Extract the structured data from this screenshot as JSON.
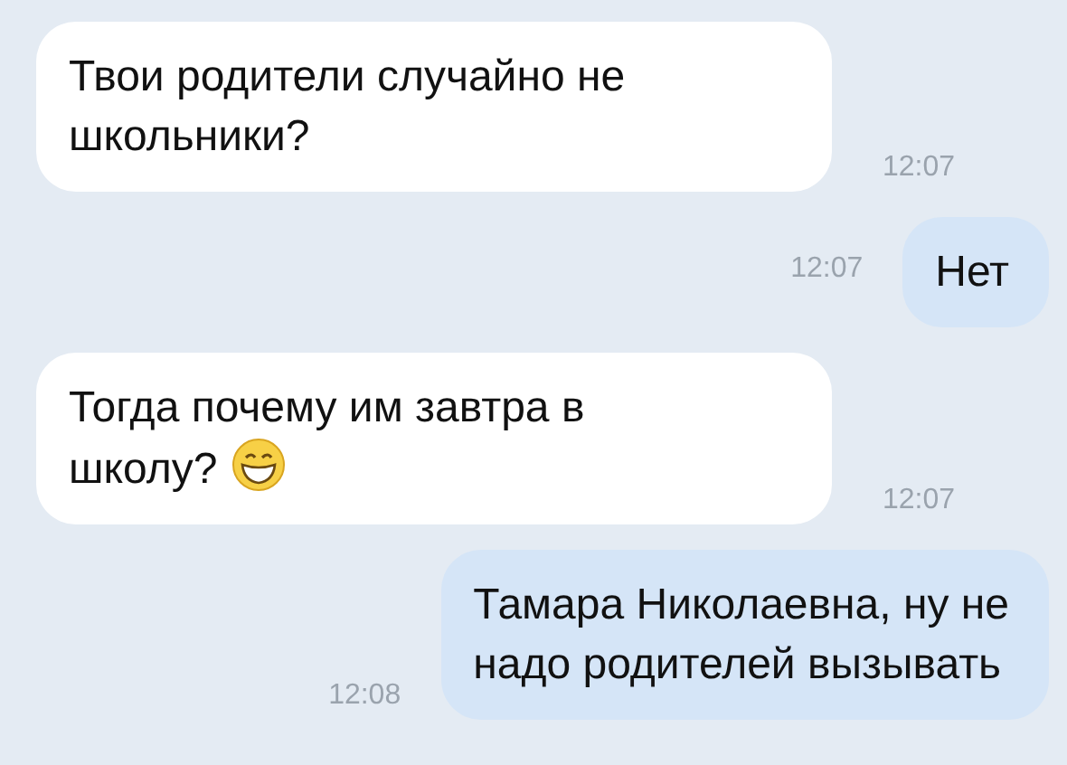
{
  "messages": [
    {
      "kind": "incoming",
      "lines": [
        "Твои родители случайно не",
        "школьники?"
      ],
      "time": "12:07"
    },
    {
      "kind": "outgoing",
      "lines": [
        "Нет"
      ],
      "time": "12:07"
    },
    {
      "kind": "incoming",
      "lines": [
        "Тогда почему им завтра в",
        "школу?"
      ],
      "emoji": true,
      "time": "12:07"
    },
    {
      "kind": "outgoing",
      "lines": [
        "Тамара Николаевна, ну не",
        "надо родителей вызывать"
      ],
      "time": "12:08"
    }
  ]
}
